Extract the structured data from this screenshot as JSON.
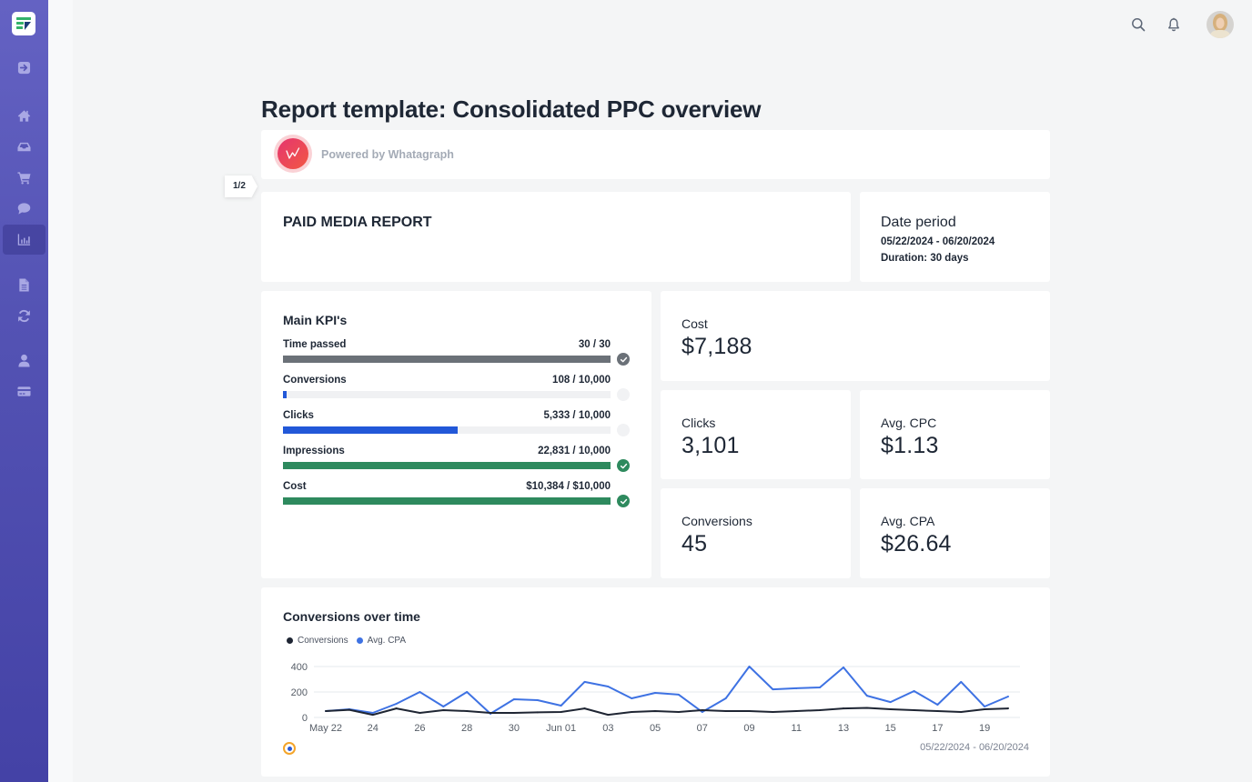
{
  "sidebar": {
    "logo": "whatagraph-logo",
    "items": [
      {
        "icon": "arrow-right-square",
        "active": false
      },
      {
        "icon": "home",
        "active": false
      },
      {
        "icon": "inbox",
        "active": false
      },
      {
        "icon": "shopping-cart",
        "active": false
      },
      {
        "icon": "chat-bubble",
        "active": false
      },
      {
        "icon": "bar-chart",
        "active": true
      },
      {
        "icon": "file",
        "active": false
      },
      {
        "icon": "refresh",
        "active": false
      },
      {
        "icon": "user",
        "active": false
      },
      {
        "icon": "credit-card",
        "active": false
      }
    ]
  },
  "topbar": {
    "search_icon": "search",
    "notifications_icon": "bell",
    "avatar": "user-avatar"
  },
  "page": {
    "title": "Report template: Consolidated PPC overview",
    "powered_by": "Powered by Whatagraph",
    "page_indicator": "1/2"
  },
  "report": {
    "title": "PAID MEDIA REPORT"
  },
  "date_period": {
    "label": "Date period",
    "range": "05/22/2024 - 06/20/2024",
    "duration_label": "Duration:",
    "duration_value": "30 days"
  },
  "colors": {
    "neutral": "#6b7178",
    "blue": "#2258d8",
    "green": "#2e8a5e",
    "pending": "#f1f2f4"
  },
  "kpis": {
    "title": "Main KPI's",
    "items": [
      {
        "label": "Time passed",
        "value": "30 / 30",
        "fill": 1.0,
        "color": "#6b7178",
        "status": "complete",
        "status_color": "#6b7178"
      },
      {
        "label": "Conversions",
        "value": "108 / 10,000",
        "fill": 0.0108,
        "color": "#2258d8",
        "status": "pending",
        "status_color": "#f1f2f4"
      },
      {
        "label": "Clicks",
        "value": "5,333 / 10,000",
        "fill": 0.5333,
        "color": "#2258d8",
        "status": "pending",
        "status_color": "#f1f2f4"
      },
      {
        "label": "Impressions",
        "value": "22,831 / 10,000",
        "fill": 1.0,
        "color": "#2e8a5e",
        "status": "complete",
        "status_color": "#2e8a5e"
      },
      {
        "label": "Cost",
        "value": "$10,384 / $10,000",
        "fill": 1.0,
        "color": "#2e8a5e",
        "status": "complete",
        "status_color": "#2e8a5e"
      }
    ]
  },
  "metrics": {
    "cost": {
      "label": "Cost",
      "value": "$7,188"
    },
    "clicks": {
      "label": "Clicks",
      "value": "3,101"
    },
    "avg_cpc": {
      "label": "Avg. CPC",
      "value": "$1.13"
    },
    "conversions": {
      "label": "Conversions",
      "value": "45"
    },
    "avg_cpa": {
      "label": "Avg. CPA",
      "value": "$26.64"
    }
  },
  "chart_data": {
    "type": "line",
    "title": "Conversions over time",
    "xlabel": "",
    "ylabel": "",
    "x": [
      "May 22",
      "May 23",
      "May 24",
      "May 25",
      "May 26",
      "May 27",
      "May 28",
      "May 29",
      "May 30",
      "May 31",
      "Jun 01",
      "Jun 02",
      "Jun 03",
      "Jun 04",
      "Jun 05",
      "Jun 06",
      "Jun 07",
      "Jun 08",
      "Jun 09",
      "Jun 10",
      "Jun 11",
      "Jun 12",
      "Jun 13",
      "Jun 14",
      "Jun 15",
      "Jun 16",
      "Jun 17",
      "Jun 18",
      "Jun 19",
      "Jun 20"
    ],
    "x_tick_labels": [
      "May 22",
      "24",
      "26",
      "28",
      "30",
      "Jun 01",
      "03",
      "05",
      "07",
      "09",
      "11",
      "13",
      "15",
      "17",
      "19"
    ],
    "x_tick_every": 2,
    "yticks": [
      0,
      200,
      400
    ],
    "ylim": [
      0,
      400
    ],
    "grid": true,
    "legend": "top-left",
    "series": [
      {
        "name": "Conversions",
        "color": "#1e2533",
        "values": [
          50,
          60,
          21,
          71,
          36,
          57,
          50,
          36,
          36,
          40,
          43,
          71,
          21,
          43,
          50,
          43,
          57,
          50,
          50,
          43,
          50,
          57,
          71,
          75,
          64,
          57,
          50,
          43,
          64,
          71
        ]
      },
      {
        "name": "Avg. CPA",
        "color": "#3e72e3",
        "values": [
          50,
          64,
          36,
          107,
          200,
          86,
          200,
          29,
          143,
          136,
          93,
          279,
          243,
          150,
          193,
          179,
          43,
          150,
          400,
          221,
          229,
          236,
          393,
          171,
          121,
          207,
          100,
          279,
          86,
          164
        ]
      }
    ],
    "date_range": "05/22/2024 - 06/20/2024"
  }
}
